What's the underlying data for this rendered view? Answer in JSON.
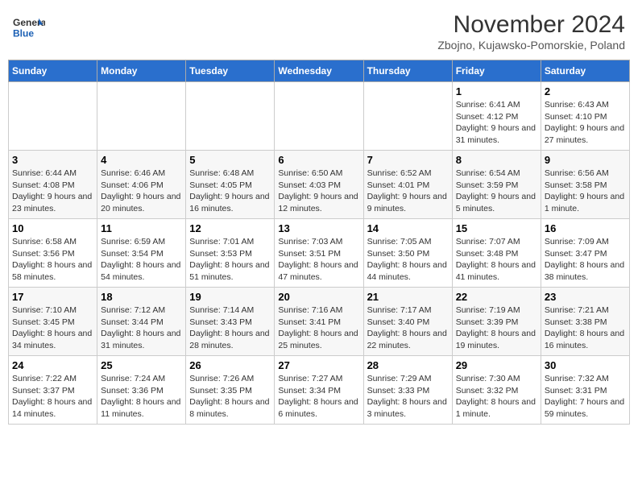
{
  "header": {
    "logo_general": "General",
    "logo_blue": "Blue",
    "month_title": "November 2024",
    "location": "Zbojno, Kujawsko-Pomorskie, Poland"
  },
  "days_of_week": [
    "Sunday",
    "Monday",
    "Tuesday",
    "Wednesday",
    "Thursday",
    "Friday",
    "Saturday"
  ],
  "weeks": [
    [
      {
        "day": "",
        "info": ""
      },
      {
        "day": "",
        "info": ""
      },
      {
        "day": "",
        "info": ""
      },
      {
        "day": "",
        "info": ""
      },
      {
        "day": "",
        "info": ""
      },
      {
        "day": "1",
        "info": "Sunrise: 6:41 AM\nSunset: 4:12 PM\nDaylight: 9 hours and 31 minutes."
      },
      {
        "day": "2",
        "info": "Sunrise: 6:43 AM\nSunset: 4:10 PM\nDaylight: 9 hours and 27 minutes."
      }
    ],
    [
      {
        "day": "3",
        "info": "Sunrise: 6:44 AM\nSunset: 4:08 PM\nDaylight: 9 hours and 23 minutes."
      },
      {
        "day": "4",
        "info": "Sunrise: 6:46 AM\nSunset: 4:06 PM\nDaylight: 9 hours and 20 minutes."
      },
      {
        "day": "5",
        "info": "Sunrise: 6:48 AM\nSunset: 4:05 PM\nDaylight: 9 hours and 16 minutes."
      },
      {
        "day": "6",
        "info": "Sunrise: 6:50 AM\nSunset: 4:03 PM\nDaylight: 9 hours and 12 minutes."
      },
      {
        "day": "7",
        "info": "Sunrise: 6:52 AM\nSunset: 4:01 PM\nDaylight: 9 hours and 9 minutes."
      },
      {
        "day": "8",
        "info": "Sunrise: 6:54 AM\nSunset: 3:59 PM\nDaylight: 9 hours and 5 minutes."
      },
      {
        "day": "9",
        "info": "Sunrise: 6:56 AM\nSunset: 3:58 PM\nDaylight: 9 hours and 1 minute."
      }
    ],
    [
      {
        "day": "10",
        "info": "Sunrise: 6:58 AM\nSunset: 3:56 PM\nDaylight: 8 hours and 58 minutes."
      },
      {
        "day": "11",
        "info": "Sunrise: 6:59 AM\nSunset: 3:54 PM\nDaylight: 8 hours and 54 minutes."
      },
      {
        "day": "12",
        "info": "Sunrise: 7:01 AM\nSunset: 3:53 PM\nDaylight: 8 hours and 51 minutes."
      },
      {
        "day": "13",
        "info": "Sunrise: 7:03 AM\nSunset: 3:51 PM\nDaylight: 8 hours and 47 minutes."
      },
      {
        "day": "14",
        "info": "Sunrise: 7:05 AM\nSunset: 3:50 PM\nDaylight: 8 hours and 44 minutes."
      },
      {
        "day": "15",
        "info": "Sunrise: 7:07 AM\nSunset: 3:48 PM\nDaylight: 8 hours and 41 minutes."
      },
      {
        "day": "16",
        "info": "Sunrise: 7:09 AM\nSunset: 3:47 PM\nDaylight: 8 hours and 38 minutes."
      }
    ],
    [
      {
        "day": "17",
        "info": "Sunrise: 7:10 AM\nSunset: 3:45 PM\nDaylight: 8 hours and 34 minutes."
      },
      {
        "day": "18",
        "info": "Sunrise: 7:12 AM\nSunset: 3:44 PM\nDaylight: 8 hours and 31 minutes."
      },
      {
        "day": "19",
        "info": "Sunrise: 7:14 AM\nSunset: 3:43 PM\nDaylight: 8 hours and 28 minutes."
      },
      {
        "day": "20",
        "info": "Sunrise: 7:16 AM\nSunset: 3:41 PM\nDaylight: 8 hours and 25 minutes."
      },
      {
        "day": "21",
        "info": "Sunrise: 7:17 AM\nSunset: 3:40 PM\nDaylight: 8 hours and 22 minutes."
      },
      {
        "day": "22",
        "info": "Sunrise: 7:19 AM\nSunset: 3:39 PM\nDaylight: 8 hours and 19 minutes."
      },
      {
        "day": "23",
        "info": "Sunrise: 7:21 AM\nSunset: 3:38 PM\nDaylight: 8 hours and 16 minutes."
      }
    ],
    [
      {
        "day": "24",
        "info": "Sunrise: 7:22 AM\nSunset: 3:37 PM\nDaylight: 8 hours and 14 minutes."
      },
      {
        "day": "25",
        "info": "Sunrise: 7:24 AM\nSunset: 3:36 PM\nDaylight: 8 hours and 11 minutes."
      },
      {
        "day": "26",
        "info": "Sunrise: 7:26 AM\nSunset: 3:35 PM\nDaylight: 8 hours and 8 minutes."
      },
      {
        "day": "27",
        "info": "Sunrise: 7:27 AM\nSunset: 3:34 PM\nDaylight: 8 hours and 6 minutes."
      },
      {
        "day": "28",
        "info": "Sunrise: 7:29 AM\nSunset: 3:33 PM\nDaylight: 8 hours and 3 minutes."
      },
      {
        "day": "29",
        "info": "Sunrise: 7:30 AM\nSunset: 3:32 PM\nDaylight: 8 hours and 1 minute."
      },
      {
        "day": "30",
        "info": "Sunrise: 7:32 AM\nSunset: 3:31 PM\nDaylight: 7 hours and 59 minutes."
      }
    ]
  ]
}
